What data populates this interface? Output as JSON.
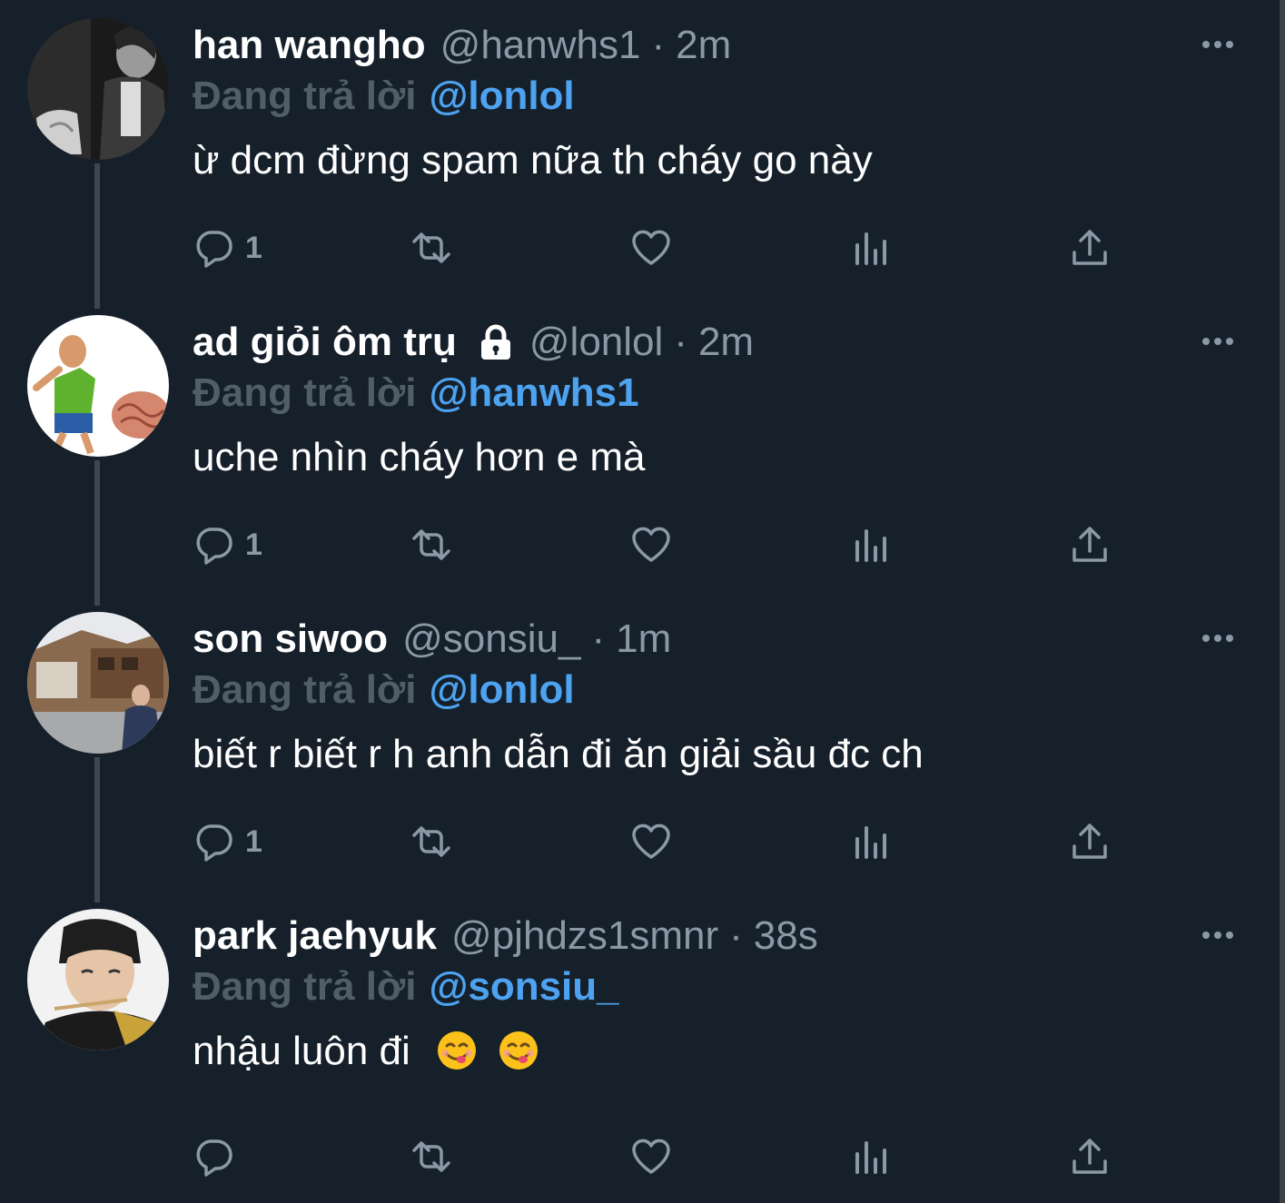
{
  "colors": {
    "background": "#16202b",
    "name": "#ffffff",
    "muted": "#8b98a5",
    "reply_prefix": "#515d69",
    "mention": "#4da3f0",
    "thread_line": "#3d4750"
  },
  "tweets": [
    {
      "display_name": "han wangho",
      "locked": false,
      "handle": "@hanwhs1",
      "separator": "·",
      "time": "2m",
      "reply_prefix": "Đang trả lời",
      "reply_target": "@lonlol",
      "text": "ừ dcm đừng spam nữa th cháy go này",
      "reply_count": "1"
    },
    {
      "display_name": "ad giỏi ôm trụ",
      "locked": true,
      "handle": "@lonlol",
      "separator": "·",
      "time": "2m",
      "reply_prefix": "Đang trả lời",
      "reply_target": "@hanwhs1",
      "text": "uche nhìn cháy hơn e mà",
      "reply_count": "1"
    },
    {
      "display_name": "son siwoo",
      "locked": false,
      "handle": "@sonsiu_",
      "separator": "·",
      "time": "1m",
      "reply_prefix": "Đang trả lời",
      "reply_target": "@lonlol",
      "text": "biết r biết r h anh dẫn đi ăn giải sầu đc ch",
      "reply_count": "1"
    },
    {
      "display_name": "park jaehyuk",
      "locked": false,
      "handle": "@pjhdzs1smnr",
      "separator": "·",
      "time": "38s",
      "reply_prefix": "Đang trả lời",
      "reply_target": "@sonsiu_",
      "text": "nhậu luôn đi",
      "emoji": [
        "yum-face-emoji",
        "yum-face-emoji"
      ],
      "reply_count": ""
    }
  ],
  "icons": {
    "reply": "reply-icon",
    "retweet": "retweet-icon",
    "like": "heart-icon",
    "analytics": "analytics-icon",
    "share": "share-icon",
    "more": "more-icon",
    "lock": "lock-icon"
  }
}
